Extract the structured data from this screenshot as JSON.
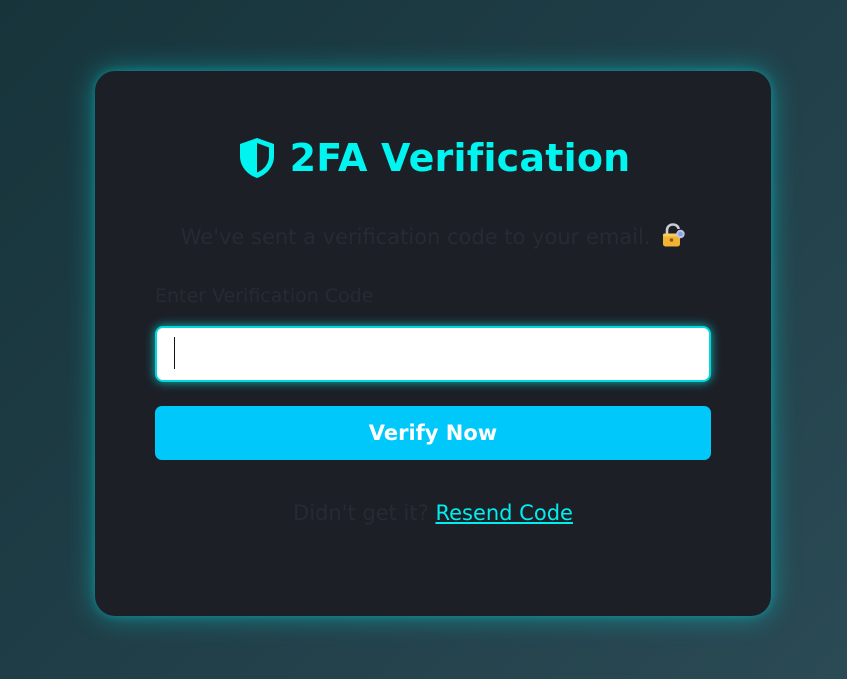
{
  "card": {
    "title": "2FA Verification",
    "title_icon": "shield-icon",
    "subtitle": "We've sent a verification code to your email.",
    "subtitle_icon": "lock-icon"
  },
  "form": {
    "label": "Enter Verification Code",
    "code_value": "",
    "verify_label": "Verify Now"
  },
  "resend": {
    "prompt": "Didn't get it?",
    "link_label": "Resend Code"
  },
  "colors": {
    "accent": "#00f5f0",
    "button": "#00c8fb",
    "card_bg": "#1c1f26"
  }
}
